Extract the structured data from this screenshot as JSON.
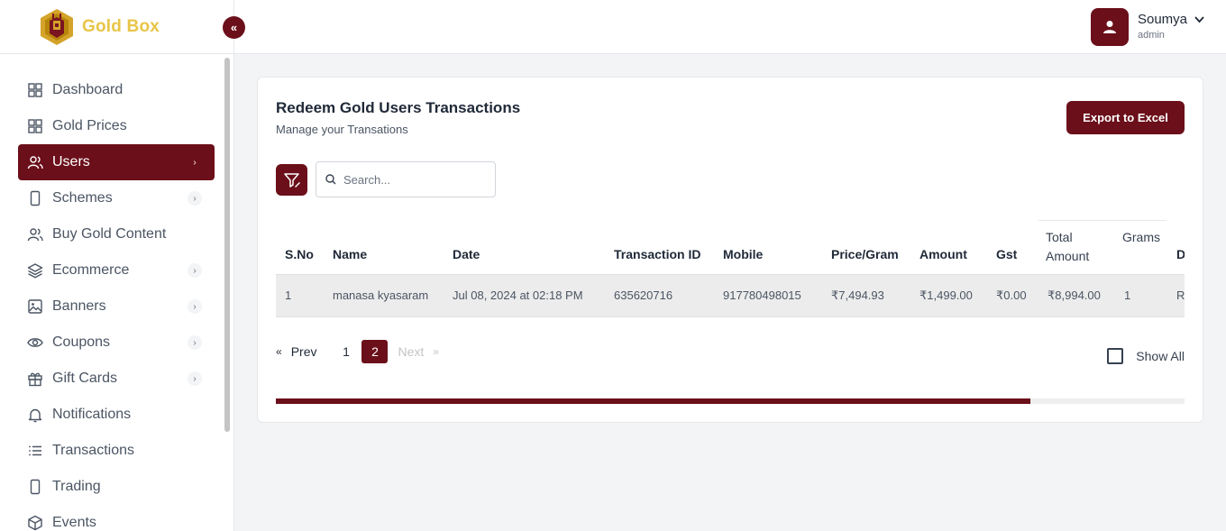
{
  "brand": {
    "name": "Gold Box",
    "logo_icon": "gold-box-logo",
    "colors": {
      "primary": "#6b0f1a",
      "gold": "#e8c547"
    }
  },
  "sidebar": {
    "items": [
      {
        "label": "Dashboard",
        "icon": "grid-icon",
        "has_children": false,
        "active": false
      },
      {
        "label": "Gold Prices",
        "icon": "grid-icon",
        "has_children": false,
        "active": false
      },
      {
        "label": "Users",
        "icon": "users-icon",
        "has_children": true,
        "active": true
      },
      {
        "label": "Schemes",
        "icon": "phone-icon",
        "has_children": true,
        "active": false
      },
      {
        "label": "Buy Gold Content",
        "icon": "users-icon",
        "has_children": false,
        "active": false
      },
      {
        "label": "Ecommerce",
        "icon": "layers-icon",
        "has_children": true,
        "active": false
      },
      {
        "label": "Banners",
        "icon": "image-icon",
        "has_children": true,
        "active": false
      },
      {
        "label": "Coupons",
        "icon": "eye-icon",
        "has_children": true,
        "active": false
      },
      {
        "label": "Gift Cards",
        "icon": "gift-icon",
        "has_children": true,
        "active": false
      },
      {
        "label": "Notifications",
        "icon": "bell-icon",
        "has_children": false,
        "active": false
      },
      {
        "label": "Transactions",
        "icon": "list-icon",
        "has_children": false,
        "active": false
      },
      {
        "label": "Trading",
        "icon": "phone-icon",
        "has_children": false,
        "active": false
      },
      {
        "label": "Events",
        "icon": "cube-icon",
        "has_children": false,
        "active": false
      }
    ]
  },
  "topbar": {
    "user": {
      "name": "Soumya",
      "role": "admin"
    }
  },
  "card": {
    "title": "Redeem Gold Users Transactions",
    "subtitle": "Manage your Transations",
    "export_label": "Export to Excel",
    "search_placeholder": "Search..."
  },
  "table": {
    "headers": [
      "S.No",
      "Name",
      "Date",
      "Transaction ID",
      "Mobile",
      "Price/Gram",
      "Amount",
      "Gst",
      "Total\nAmount",
      "Grams",
      "D"
    ],
    "rows": [
      [
        "1",
        "manasa kyasaram",
        "Jul 08, 2024 at 02:18 PM",
        "635620716",
        "917780498015",
        "₹7,494.93",
        "₹1,499.00",
        "₹0.00",
        "₹8,994.00",
        "1",
        "R"
      ]
    ]
  },
  "pagination": {
    "prev": "Prev",
    "next": "Next",
    "pages": [
      "1",
      "2"
    ],
    "current": "2",
    "first_glyph": "«",
    "last_glyph": "»"
  },
  "show_all_label": "Show All",
  "table_scroll": {
    "position_fraction": 0.0,
    "visible_fraction": 0.83
  }
}
